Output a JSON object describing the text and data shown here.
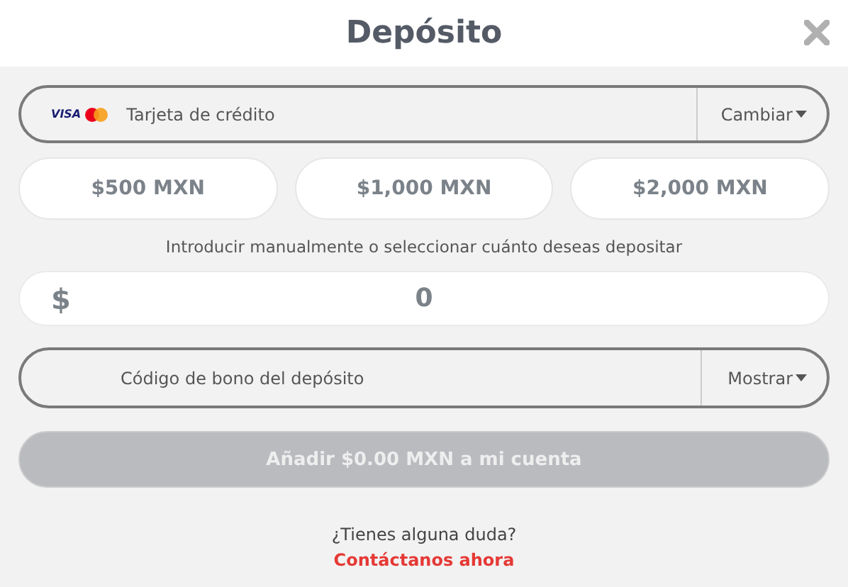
{
  "title": "Depósito",
  "payment": {
    "brand": "VISA",
    "label": "Tarjeta de crédito",
    "action": "Cambiar"
  },
  "amounts": [
    {
      "label": "$500 MXN"
    },
    {
      "label": "$1,000 MXN"
    },
    {
      "label": "$2,000 MXN"
    }
  ],
  "hint": "Introducir manualmente o seleccionar cuánto deseas depositar",
  "amount_field": {
    "currency": "$",
    "value": "0"
  },
  "bonus": {
    "placeholder": "Código de bono del depósito",
    "action": "Mostrar"
  },
  "submit": {
    "label": "Añadir $0.00 MXN a mi cuenta",
    "disabled": true
  },
  "help": {
    "question": "¿Tienes alguna duda?",
    "link": "Contáctanos ahora"
  }
}
